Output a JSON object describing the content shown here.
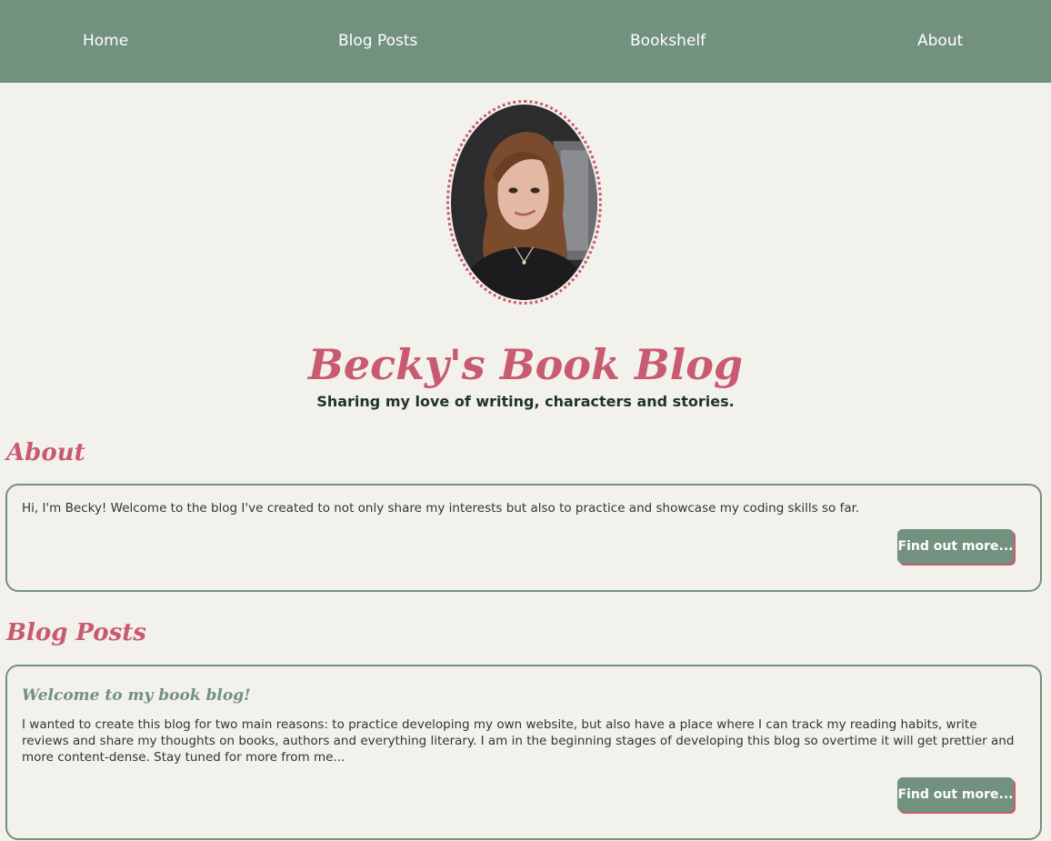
{
  "nav": {
    "items": [
      {
        "label": "Home"
      },
      {
        "label": "Blog Posts"
      },
      {
        "label": "Bookshelf"
      },
      {
        "label": "About"
      }
    ]
  },
  "header": {
    "title": "Becky's Book Blog",
    "tagline": "Sharing my love of writing, characters and stories."
  },
  "about": {
    "heading": "About",
    "text": "Hi, I'm Becky! Welcome to the blog I've created to not only share my interests but also to practice and showcase my coding skills so far.",
    "button_label": "Find out more..."
  },
  "blog_posts": {
    "heading": "Blog Posts",
    "posts": [
      {
        "title": "Welcome to my book blog!",
        "excerpt": "I wanted to create this blog for two main reasons: to practice developing my own website, but also have a place where I can track my reading habits, write reviews and share my thoughts on books, authors and everything literary. I am in the beginning stages of developing this blog so overtime it will get prettier and more content-dense. Stay tuned for more from me...",
        "button_label": "Find out more..."
      }
    ]
  },
  "colors": {
    "nav_background": "#72917f",
    "page_background": "#f3f1ec",
    "accent_pink": "#c85b6f",
    "text_dark": "#1f3527"
  }
}
